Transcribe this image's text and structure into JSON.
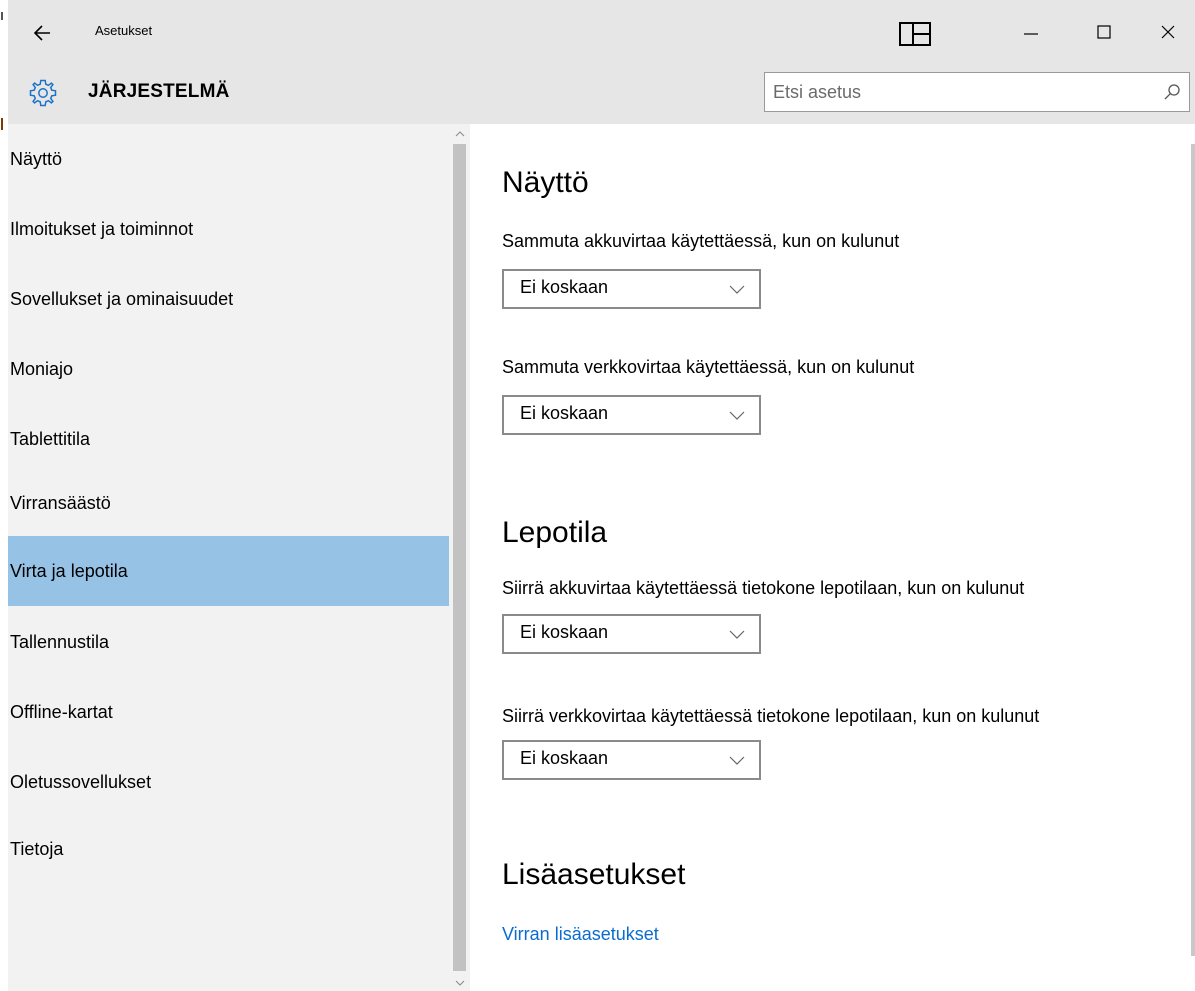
{
  "window": {
    "app_title": "Asetukset",
    "back_icon": "arrow-left-icon",
    "snap_icon": "tablet-snap-icon",
    "minimize_icon": "minimize-icon",
    "maximize_icon": "maximize-icon",
    "close_icon": "close-icon"
  },
  "header": {
    "icon": "gear-icon",
    "title": "JÄRJESTELMÄ",
    "search_placeholder": "Etsi asetus",
    "search_icon": "search-icon"
  },
  "sidebar": {
    "items": [
      {
        "label": "Näyttö",
        "selected": false
      },
      {
        "label": "Ilmoitukset ja toiminnot",
        "selected": false
      },
      {
        "label": "Sovellukset ja ominaisuudet",
        "selected": false
      },
      {
        "label": "Moniajo",
        "selected": false
      },
      {
        "label": "Tablettitila",
        "selected": false
      },
      {
        "label": "Virransäästö",
        "selected": false
      },
      {
        "label": "Virta ja lepotila",
        "selected": true
      },
      {
        "label": "Tallennustila",
        "selected": false
      },
      {
        "label": "Offline-kartat",
        "selected": false
      },
      {
        "label": "Oletussovellukset",
        "selected": false
      },
      {
        "label": "Tietoja",
        "selected": false
      }
    ],
    "selected_color": "#96c2e6"
  },
  "content": {
    "screen_heading": "Näyttö",
    "screen_battery_label": "Sammuta akkuvirtaa käytettäessä, kun on kulunut",
    "screen_battery_value": "Ei koskaan",
    "screen_plugged_label": "Sammuta verkkovirtaa käytettäessä, kun on kulunut",
    "screen_plugged_value": "Ei koskaan",
    "sleep_heading": "Lepotila",
    "sleep_battery_label": "Siirrä akkuvirtaa käytettäessä tietokone lepotilaan, kun on kulunut",
    "sleep_battery_value": "Ei koskaan",
    "sleep_plugged_label": "Siirrä verkkovirtaa käytettäessä tietokone lepotilaan, kun on kulunut",
    "sleep_plugged_value": "Ei koskaan",
    "advanced_heading": "Lisäasetukset",
    "advanced_link": "Virran lisäasetukset",
    "link_color": "#0a6ccf"
  }
}
